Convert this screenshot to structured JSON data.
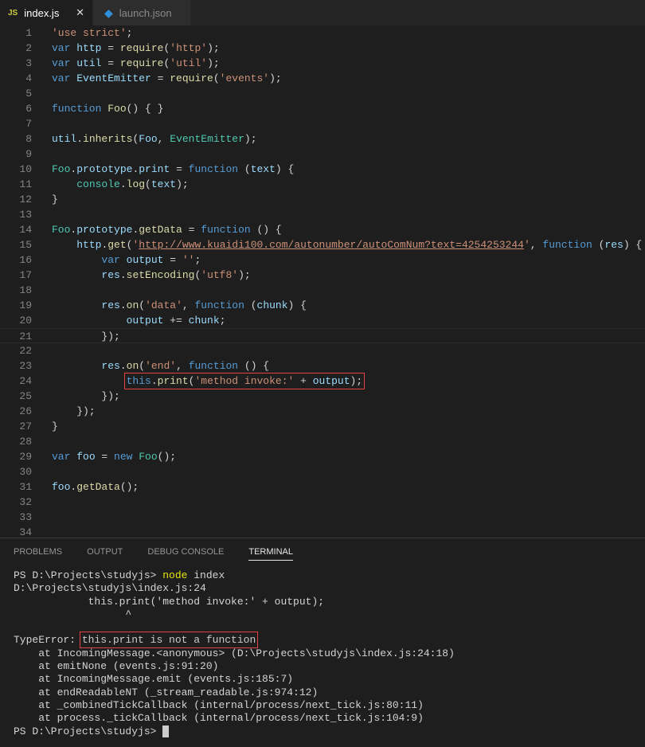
{
  "tabs": [
    {
      "label": "index.js",
      "icon": "JS",
      "active": true,
      "close": "✕"
    },
    {
      "label": "launch.json",
      "icon": "vscode-icon",
      "active": false
    }
  ],
  "editor": {
    "current_line": 21,
    "lines": [
      {
        "n": "1",
        "t": [
          [
            "s",
            "'use strict'"
          ],
          [
            "p",
            ";"
          ]
        ]
      },
      {
        "n": "2",
        "t": [
          [
            "k",
            "var "
          ],
          [
            "v",
            "http"
          ],
          [
            "p",
            " = "
          ],
          [
            "f",
            "require"
          ],
          [
            "p",
            "("
          ],
          [
            "s",
            "'http'"
          ],
          [
            "p",
            ");"
          ]
        ]
      },
      {
        "n": "3",
        "t": [
          [
            "k",
            "var "
          ],
          [
            "v",
            "util"
          ],
          [
            "p",
            " = "
          ],
          [
            "f",
            "require"
          ],
          [
            "p",
            "("
          ],
          [
            "s",
            "'util'"
          ],
          [
            "p",
            ");"
          ]
        ]
      },
      {
        "n": "4",
        "t": [
          [
            "k",
            "var "
          ],
          [
            "v",
            "EventEmitter"
          ],
          [
            "p",
            " = "
          ],
          [
            "f",
            "require"
          ],
          [
            "p",
            "("
          ],
          [
            "s",
            "'events'"
          ],
          [
            "p",
            ");"
          ]
        ]
      },
      {
        "n": "5",
        "t": []
      },
      {
        "n": "6",
        "t": [
          [
            "k",
            "function "
          ],
          [
            "f",
            "Foo"
          ],
          [
            "p",
            "() { }"
          ]
        ]
      },
      {
        "n": "7",
        "t": []
      },
      {
        "n": "8",
        "t": [
          [
            "v",
            "util"
          ],
          [
            "p",
            "."
          ],
          [
            "f",
            "inherits"
          ],
          [
            "p",
            "("
          ],
          [
            "v",
            "Foo"
          ],
          [
            "p",
            ", "
          ],
          [
            "c",
            "EventEmitter"
          ],
          [
            "p",
            ");"
          ]
        ]
      },
      {
        "n": "9",
        "t": []
      },
      {
        "n": "10",
        "t": [
          [
            "c",
            "Foo"
          ],
          [
            "p",
            "."
          ],
          [
            "v",
            "prototype"
          ],
          [
            "p",
            "."
          ],
          [
            "v",
            "print"
          ],
          [
            "p",
            " = "
          ],
          [
            "k",
            "function "
          ],
          [
            "p",
            "("
          ],
          [
            "v",
            "text"
          ],
          [
            "p",
            ") {"
          ]
        ]
      },
      {
        "n": "11",
        "t": [
          [
            "p",
            "    "
          ],
          [
            "c",
            "console"
          ],
          [
            "p",
            "."
          ],
          [
            "f",
            "log"
          ],
          [
            "p",
            "("
          ],
          [
            "v",
            "text"
          ],
          [
            "p",
            ");"
          ]
        ]
      },
      {
        "n": "12",
        "t": [
          [
            "p",
            "}"
          ]
        ]
      },
      {
        "n": "13",
        "t": []
      },
      {
        "n": "14",
        "t": [
          [
            "c",
            "Foo"
          ],
          [
            "p",
            "."
          ],
          [
            "v",
            "prototype"
          ],
          [
            "p",
            "."
          ],
          [
            "f",
            "getData"
          ],
          [
            "p",
            " = "
          ],
          [
            "k",
            "function "
          ],
          [
            "p",
            "() {"
          ]
        ]
      },
      {
        "n": "15",
        "t": [
          [
            "p",
            "    "
          ],
          [
            "v",
            "http"
          ],
          [
            "p",
            "."
          ],
          [
            "f",
            "get"
          ],
          [
            "p",
            "("
          ],
          [
            "s",
            "'"
          ],
          [
            "u",
            "http://www.kuaidi100.com/autonumber/autoComNum?text=4254253244"
          ],
          [
            "s",
            "'"
          ],
          [
            "p",
            ", "
          ],
          [
            "k",
            "function "
          ],
          [
            "p",
            "("
          ],
          [
            "v",
            "res"
          ],
          [
            "p",
            ") {"
          ]
        ]
      },
      {
        "n": "16",
        "t": [
          [
            "p",
            "        "
          ],
          [
            "k",
            "var "
          ],
          [
            "v",
            "output"
          ],
          [
            "p",
            " = "
          ],
          [
            "s",
            "''"
          ],
          [
            "p",
            ";"
          ]
        ]
      },
      {
        "n": "17",
        "t": [
          [
            "p",
            "        "
          ],
          [
            "v",
            "res"
          ],
          [
            "p",
            "."
          ],
          [
            "f",
            "setEncoding"
          ],
          [
            "p",
            "("
          ],
          [
            "s",
            "'utf8'"
          ],
          [
            "p",
            ");"
          ]
        ]
      },
      {
        "n": "18",
        "t": []
      },
      {
        "n": "19",
        "t": [
          [
            "p",
            "        "
          ],
          [
            "v",
            "res"
          ],
          [
            "p",
            "."
          ],
          [
            "f",
            "on"
          ],
          [
            "p",
            "("
          ],
          [
            "s",
            "'data'"
          ],
          [
            "p",
            ", "
          ],
          [
            "k",
            "function "
          ],
          [
            "p",
            "("
          ],
          [
            "v",
            "chunk"
          ],
          [
            "p",
            ") {"
          ]
        ]
      },
      {
        "n": "20",
        "t": [
          [
            "p",
            "            "
          ],
          [
            "v",
            "output"
          ],
          [
            "p",
            " += "
          ],
          [
            "v",
            "chunk"
          ],
          [
            "p",
            ";"
          ]
        ]
      },
      {
        "n": "21",
        "t": [
          [
            "p",
            "        });"
          ]
        ]
      },
      {
        "n": "22",
        "t": []
      },
      {
        "n": "23",
        "t": [
          [
            "p",
            "        "
          ],
          [
            "v",
            "res"
          ],
          [
            "p",
            "."
          ],
          [
            "f",
            "on"
          ],
          [
            "p",
            "("
          ],
          [
            "s",
            "'end'"
          ],
          [
            "p",
            ", "
          ],
          [
            "k",
            "function "
          ],
          [
            "p",
            "() {"
          ]
        ]
      },
      {
        "n": "24",
        "boxed": true,
        "t": [
          [
            "p",
            "            "
          ],
          [
            "k",
            "this"
          ],
          [
            "p",
            "."
          ],
          [
            "f",
            "print"
          ],
          [
            "p",
            "("
          ],
          [
            "s",
            "'method invoke:'"
          ],
          [
            "p",
            " + "
          ],
          [
            "v",
            "output"
          ],
          [
            "p",
            ");"
          ]
        ]
      },
      {
        "n": "25",
        "t": [
          [
            "p",
            "        });"
          ]
        ]
      },
      {
        "n": "26",
        "t": [
          [
            "p",
            "    });"
          ]
        ]
      },
      {
        "n": "27",
        "t": [
          [
            "p",
            "}"
          ]
        ]
      },
      {
        "n": "28",
        "t": []
      },
      {
        "n": "29",
        "t": [
          [
            "k",
            "var "
          ],
          [
            "v",
            "foo"
          ],
          [
            "p",
            " = "
          ],
          [
            "k",
            "new "
          ],
          [
            "c",
            "Foo"
          ],
          [
            "p",
            "();"
          ]
        ]
      },
      {
        "n": "30",
        "t": []
      },
      {
        "n": "31",
        "t": [
          [
            "v",
            "foo"
          ],
          [
            "p",
            "."
          ],
          [
            "f",
            "getData"
          ],
          [
            "p",
            "();"
          ]
        ]
      },
      {
        "n": "32",
        "t": []
      },
      {
        "n": "33",
        "t": []
      },
      {
        "n": "34",
        "t": []
      }
    ]
  },
  "panel": {
    "tabs": [
      {
        "label": "PROBLEMS"
      },
      {
        "label": "OUTPUT"
      },
      {
        "label": "DEBUG CONSOLE"
      },
      {
        "label": "TERMINAL",
        "active": true
      }
    ]
  },
  "terminal": {
    "lines": [
      [
        [
          "p",
          "PS D:\\Projects\\studyjs> "
        ],
        [
          "y",
          "node"
        ],
        [
          "p",
          " index"
        ]
      ],
      [
        [
          "p",
          "D:\\Projects\\studyjs\\index.js:24"
        ]
      ],
      [
        [
          "p",
          "            this.print('method invoke:' + output);"
        ]
      ],
      [
        [
          "p",
          "                  ^"
        ]
      ],
      [],
      [
        [
          "p",
          "TypeError: "
        ],
        [
          "box",
          "this.print is not a function"
        ]
      ],
      [
        [
          "p",
          "    at IncomingMessage.<anonymous> (D:\\Projects\\studyjs\\index.js:24:18)"
        ]
      ],
      [
        [
          "p",
          "    at emitNone (events.js:91:20)"
        ]
      ],
      [
        [
          "p",
          "    at IncomingMessage.emit (events.js:185:7)"
        ]
      ],
      [
        [
          "p",
          "    at endReadableNT (_stream_readable.js:974:12)"
        ]
      ],
      [
        [
          "p",
          "    at _combinedTickCallback (internal/process/next_tick.js:80:11)"
        ]
      ],
      [
        [
          "p",
          "    at process._tickCallback (internal/process/next_tick.js:104:9)"
        ]
      ],
      [
        [
          "p",
          "PS D:\\Projects\\studyjs> "
        ],
        [
          "cursor",
          ""
        ]
      ]
    ]
  },
  "colors": {
    "keyword": "#569cd6",
    "string": "#ce9178",
    "variable": "#9cdcfe",
    "function": "#dcdcaa",
    "type": "#4ec9b0",
    "highlight_box": "#e04343"
  }
}
